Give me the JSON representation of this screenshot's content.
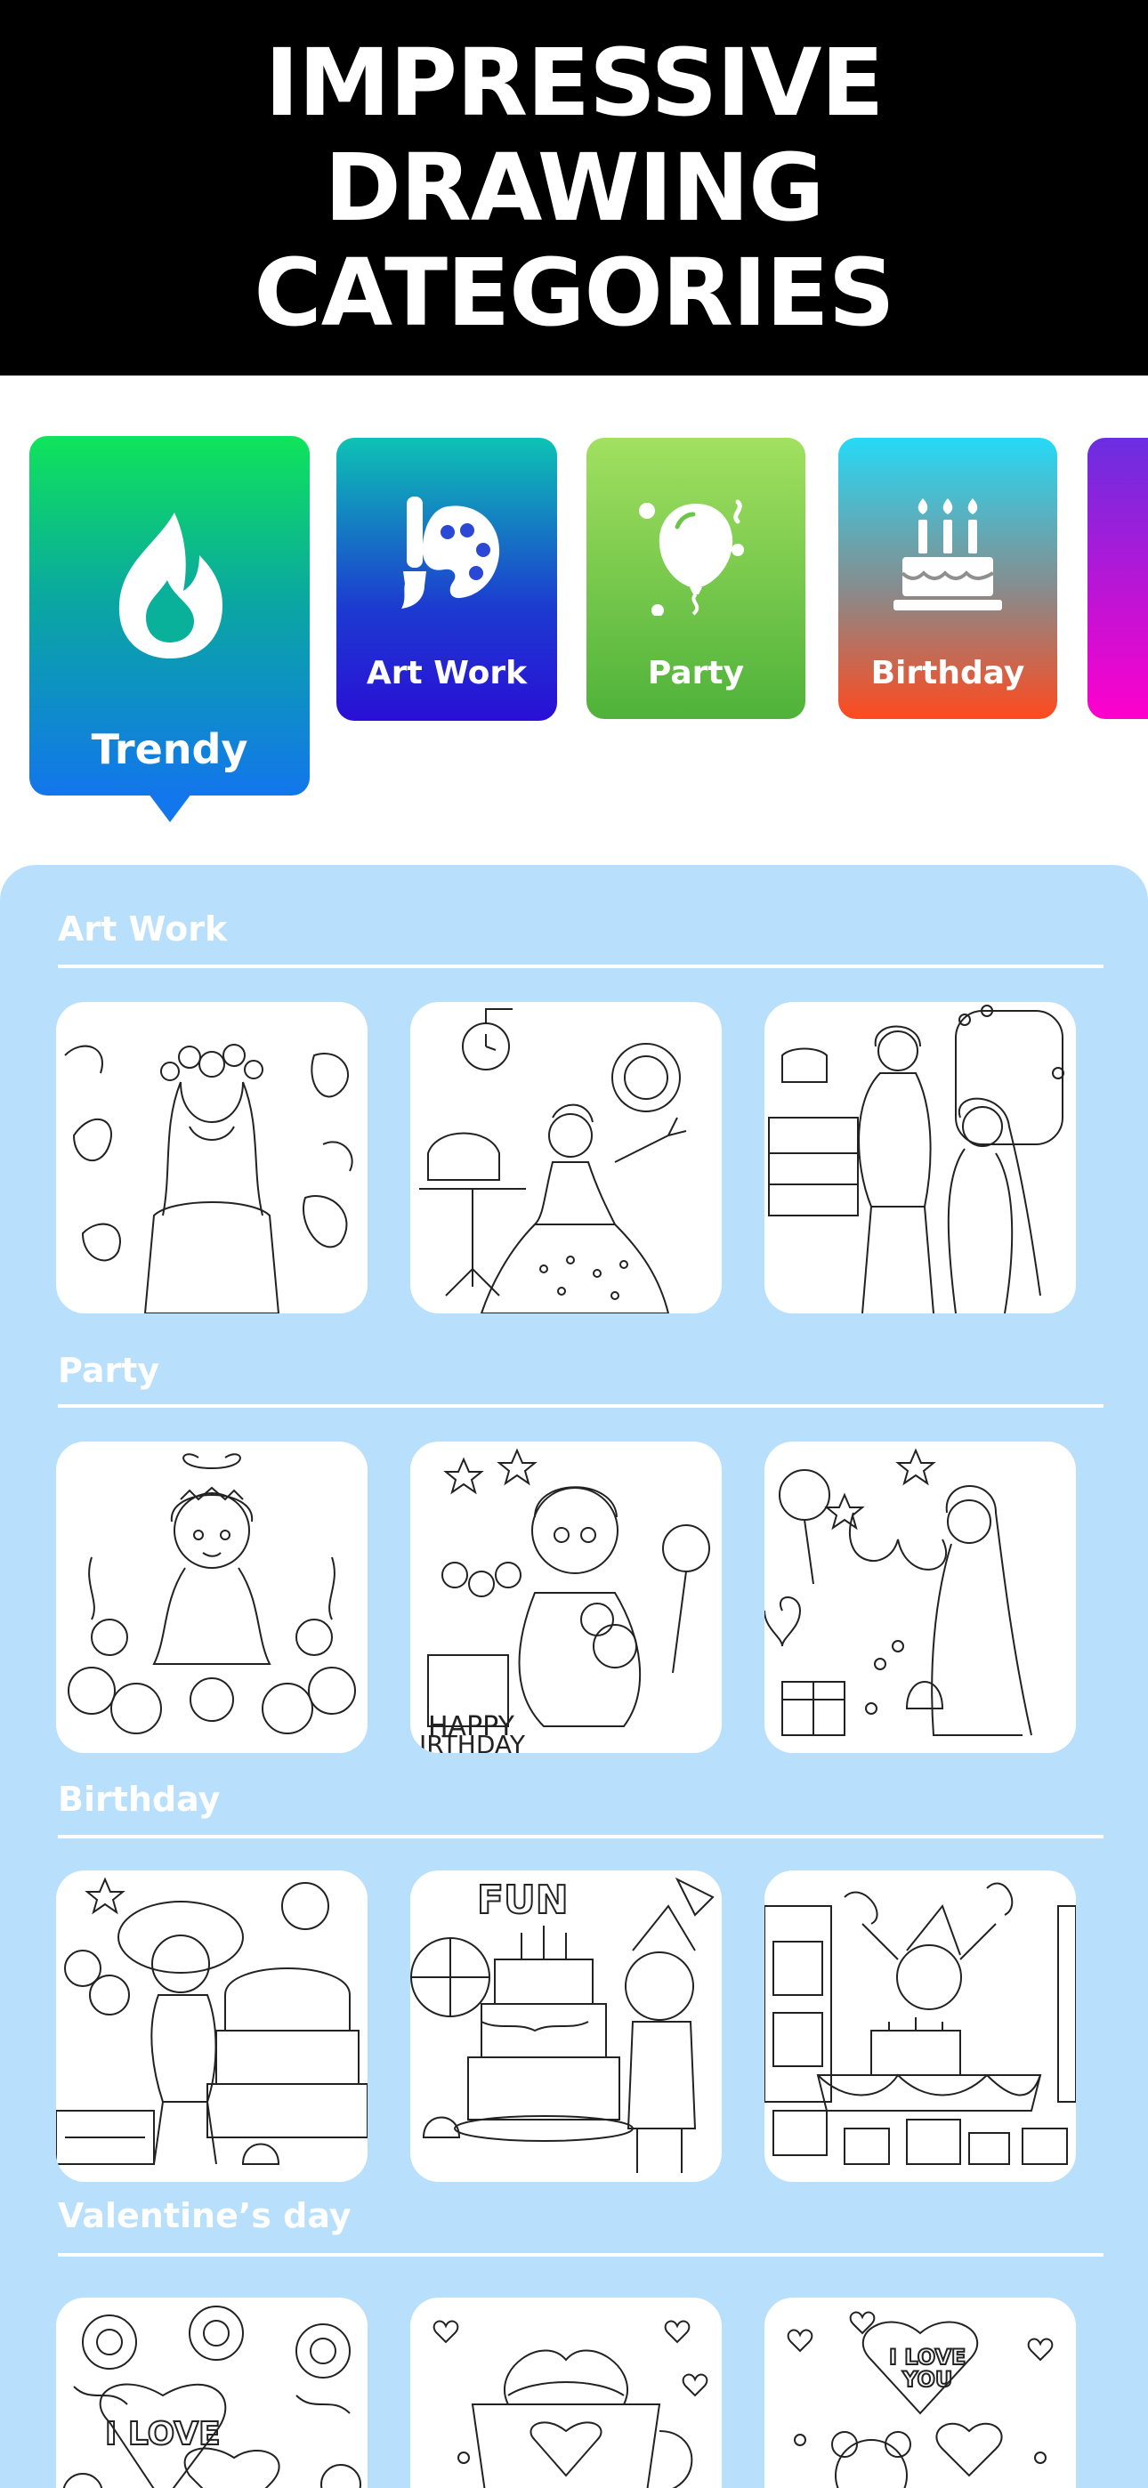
{
  "hero": {
    "title": "IMPRESSIVE DRAWING CATEGORIES"
  },
  "categories": [
    {
      "label": "Trendy",
      "icon": "flame-icon",
      "selected": true
    },
    {
      "label": "Art Work",
      "icon": "palette-brush-icon"
    },
    {
      "label": "Party",
      "icon": "balloon-icon"
    },
    {
      "label": "Birthday",
      "icon": "birthday-cake-icon"
    },
    {
      "label": "",
      "icon": ""
    }
  ],
  "sections": [
    {
      "title": "Art Work",
      "items": [
        "flower-crown-girl",
        "princess-in-room",
        "hair-salon"
      ]
    },
    {
      "title": "Party",
      "items": [
        "girl-with-flowers",
        "happy-birthday-girl",
        "party-princess"
      ]
    },
    {
      "title": "Birthday",
      "items": [
        "strawberry-cake-party",
        "fun-cake-boy",
        "birthday-boy-table"
      ]
    },
    {
      "title": "Valentine’s day",
      "items": [
        "i-love-you-heart",
        "valentine-cup",
        "i-love-you-bear"
      ]
    }
  ]
}
